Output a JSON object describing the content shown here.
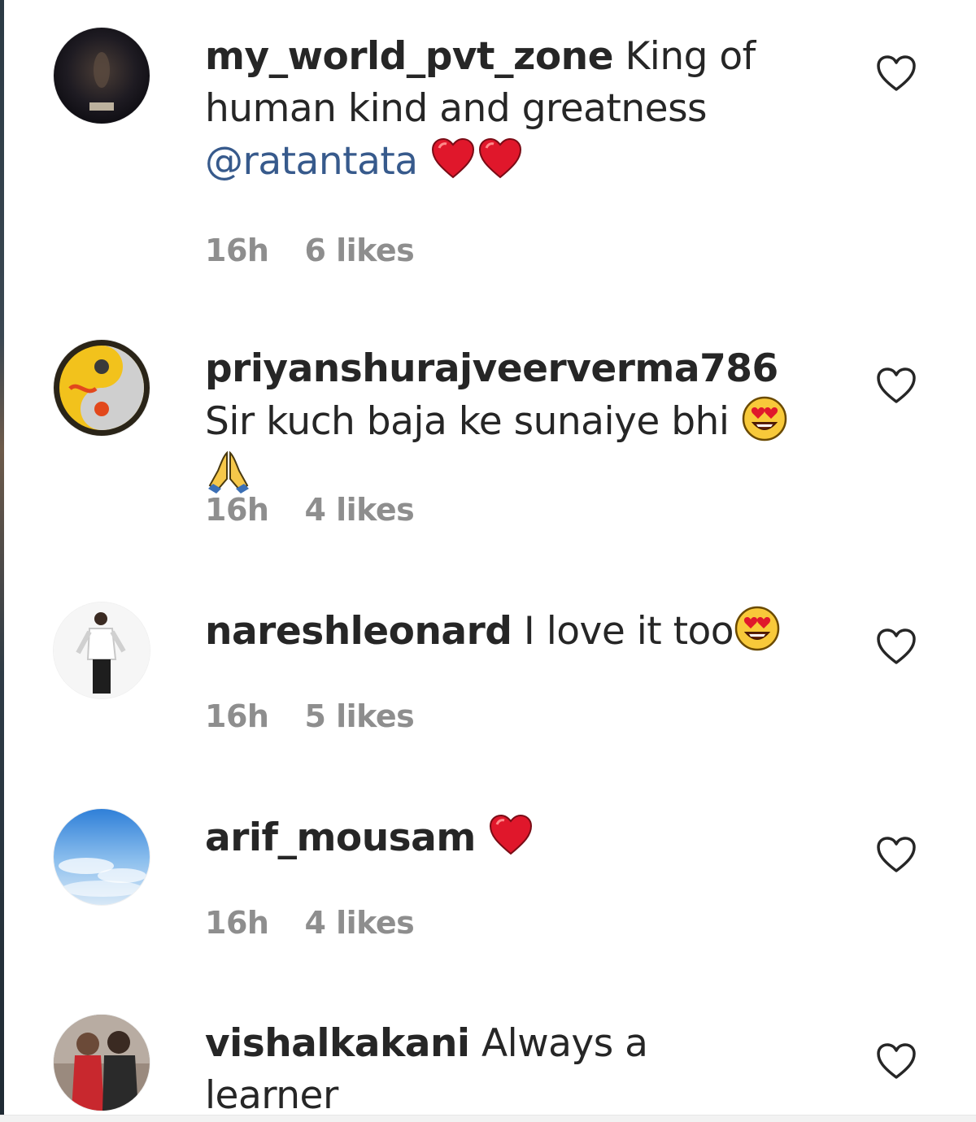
{
  "comments": [
    {
      "username": "my_world_pvt_zone",
      "text": "King of human kind and greatness",
      "mention": "@ratantata",
      "emojis": [
        "red-heart",
        "red-heart"
      ],
      "time": "16h",
      "likes": "6 likes"
    },
    {
      "username": "priyanshurajveerverma786",
      "text": "Sir kuch baja ke sunaiye bhi",
      "emojis": [
        "heart-eyes",
        "folded-hands"
      ],
      "time": "16h",
      "likes": "4 likes"
    },
    {
      "username": "nareshleonard",
      "text": "I love it too",
      "emojis": [
        "heart-eyes"
      ],
      "time": "16h",
      "likes": "5 likes"
    },
    {
      "username": "arif_mousam",
      "text": "",
      "emojis": [
        "red-heart"
      ],
      "time": "16h",
      "likes": "4 likes"
    },
    {
      "username": "vishalkakani",
      "text": "Always a learner",
      "emojis": [],
      "time": "",
      "likes": ""
    }
  ],
  "icons": {
    "like": "heart-outline-icon"
  },
  "colors": {
    "text": "#262626",
    "meta": "#8e8e8e",
    "mention": "#375a8c",
    "heart_emoji": "#e0172b"
  }
}
